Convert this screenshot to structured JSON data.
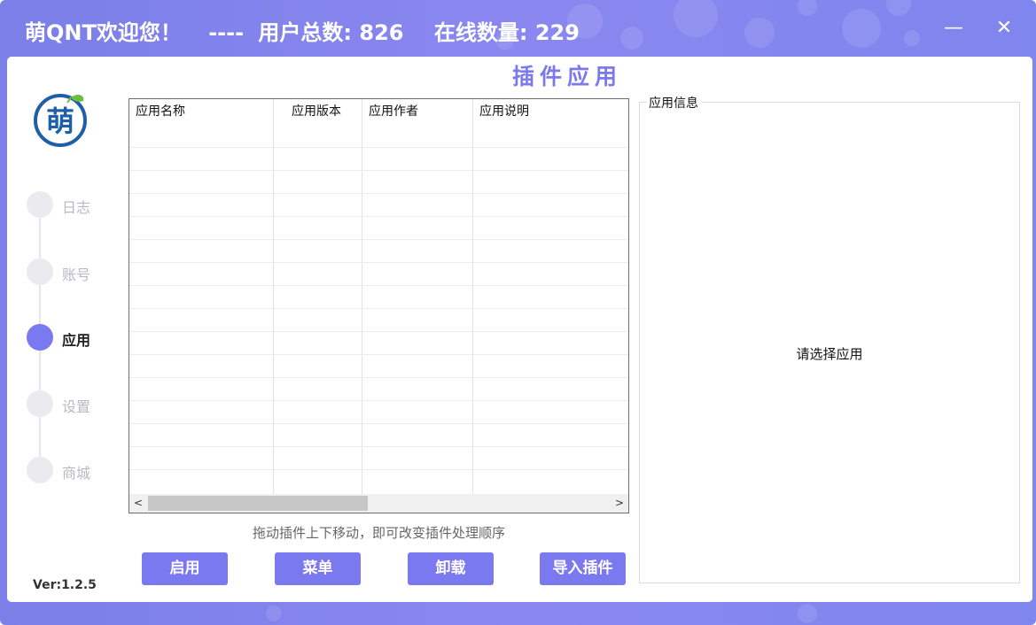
{
  "titlebar": {
    "welcome": "萌QNT欢迎您！",
    "separator": "----",
    "user_count_label": "用户总数:",
    "user_count": "826",
    "online_label": "在线数量:",
    "online_count": "229",
    "minimize_glyph": "—",
    "close_glyph": "✕"
  },
  "page_title": "插件应用",
  "logo": {
    "char": "萌",
    "icon": "leaf-logo-icon",
    "color": "#1f5fa8",
    "leaf_color": "#6bbf3f"
  },
  "sidebar": {
    "items": [
      {
        "label": "日志",
        "active": false
      },
      {
        "label": "账号",
        "active": false
      },
      {
        "label": "应用",
        "active": true
      },
      {
        "label": "设置",
        "active": false
      },
      {
        "label": "商城",
        "active": false
      }
    ],
    "version": "Ver:1.2.5"
  },
  "table": {
    "columns": [
      "应用名称",
      "应用版本",
      "应用作者",
      "应用说明"
    ],
    "rows": [],
    "scroll_left": "<",
    "scroll_right": ">"
  },
  "hint": "拖动插件上下移动，即可改变插件处理顺序",
  "buttons": {
    "enable": "启用",
    "menu": "菜单",
    "uninstall": "卸载",
    "import": "导入插件"
  },
  "info_panel": {
    "legend": "应用信息",
    "placeholder": "请选择应用"
  },
  "colors": {
    "accent": "#7b79ef",
    "header_gradient_start": "#7b7fe8",
    "header_gradient_end": "#7f86ee"
  }
}
